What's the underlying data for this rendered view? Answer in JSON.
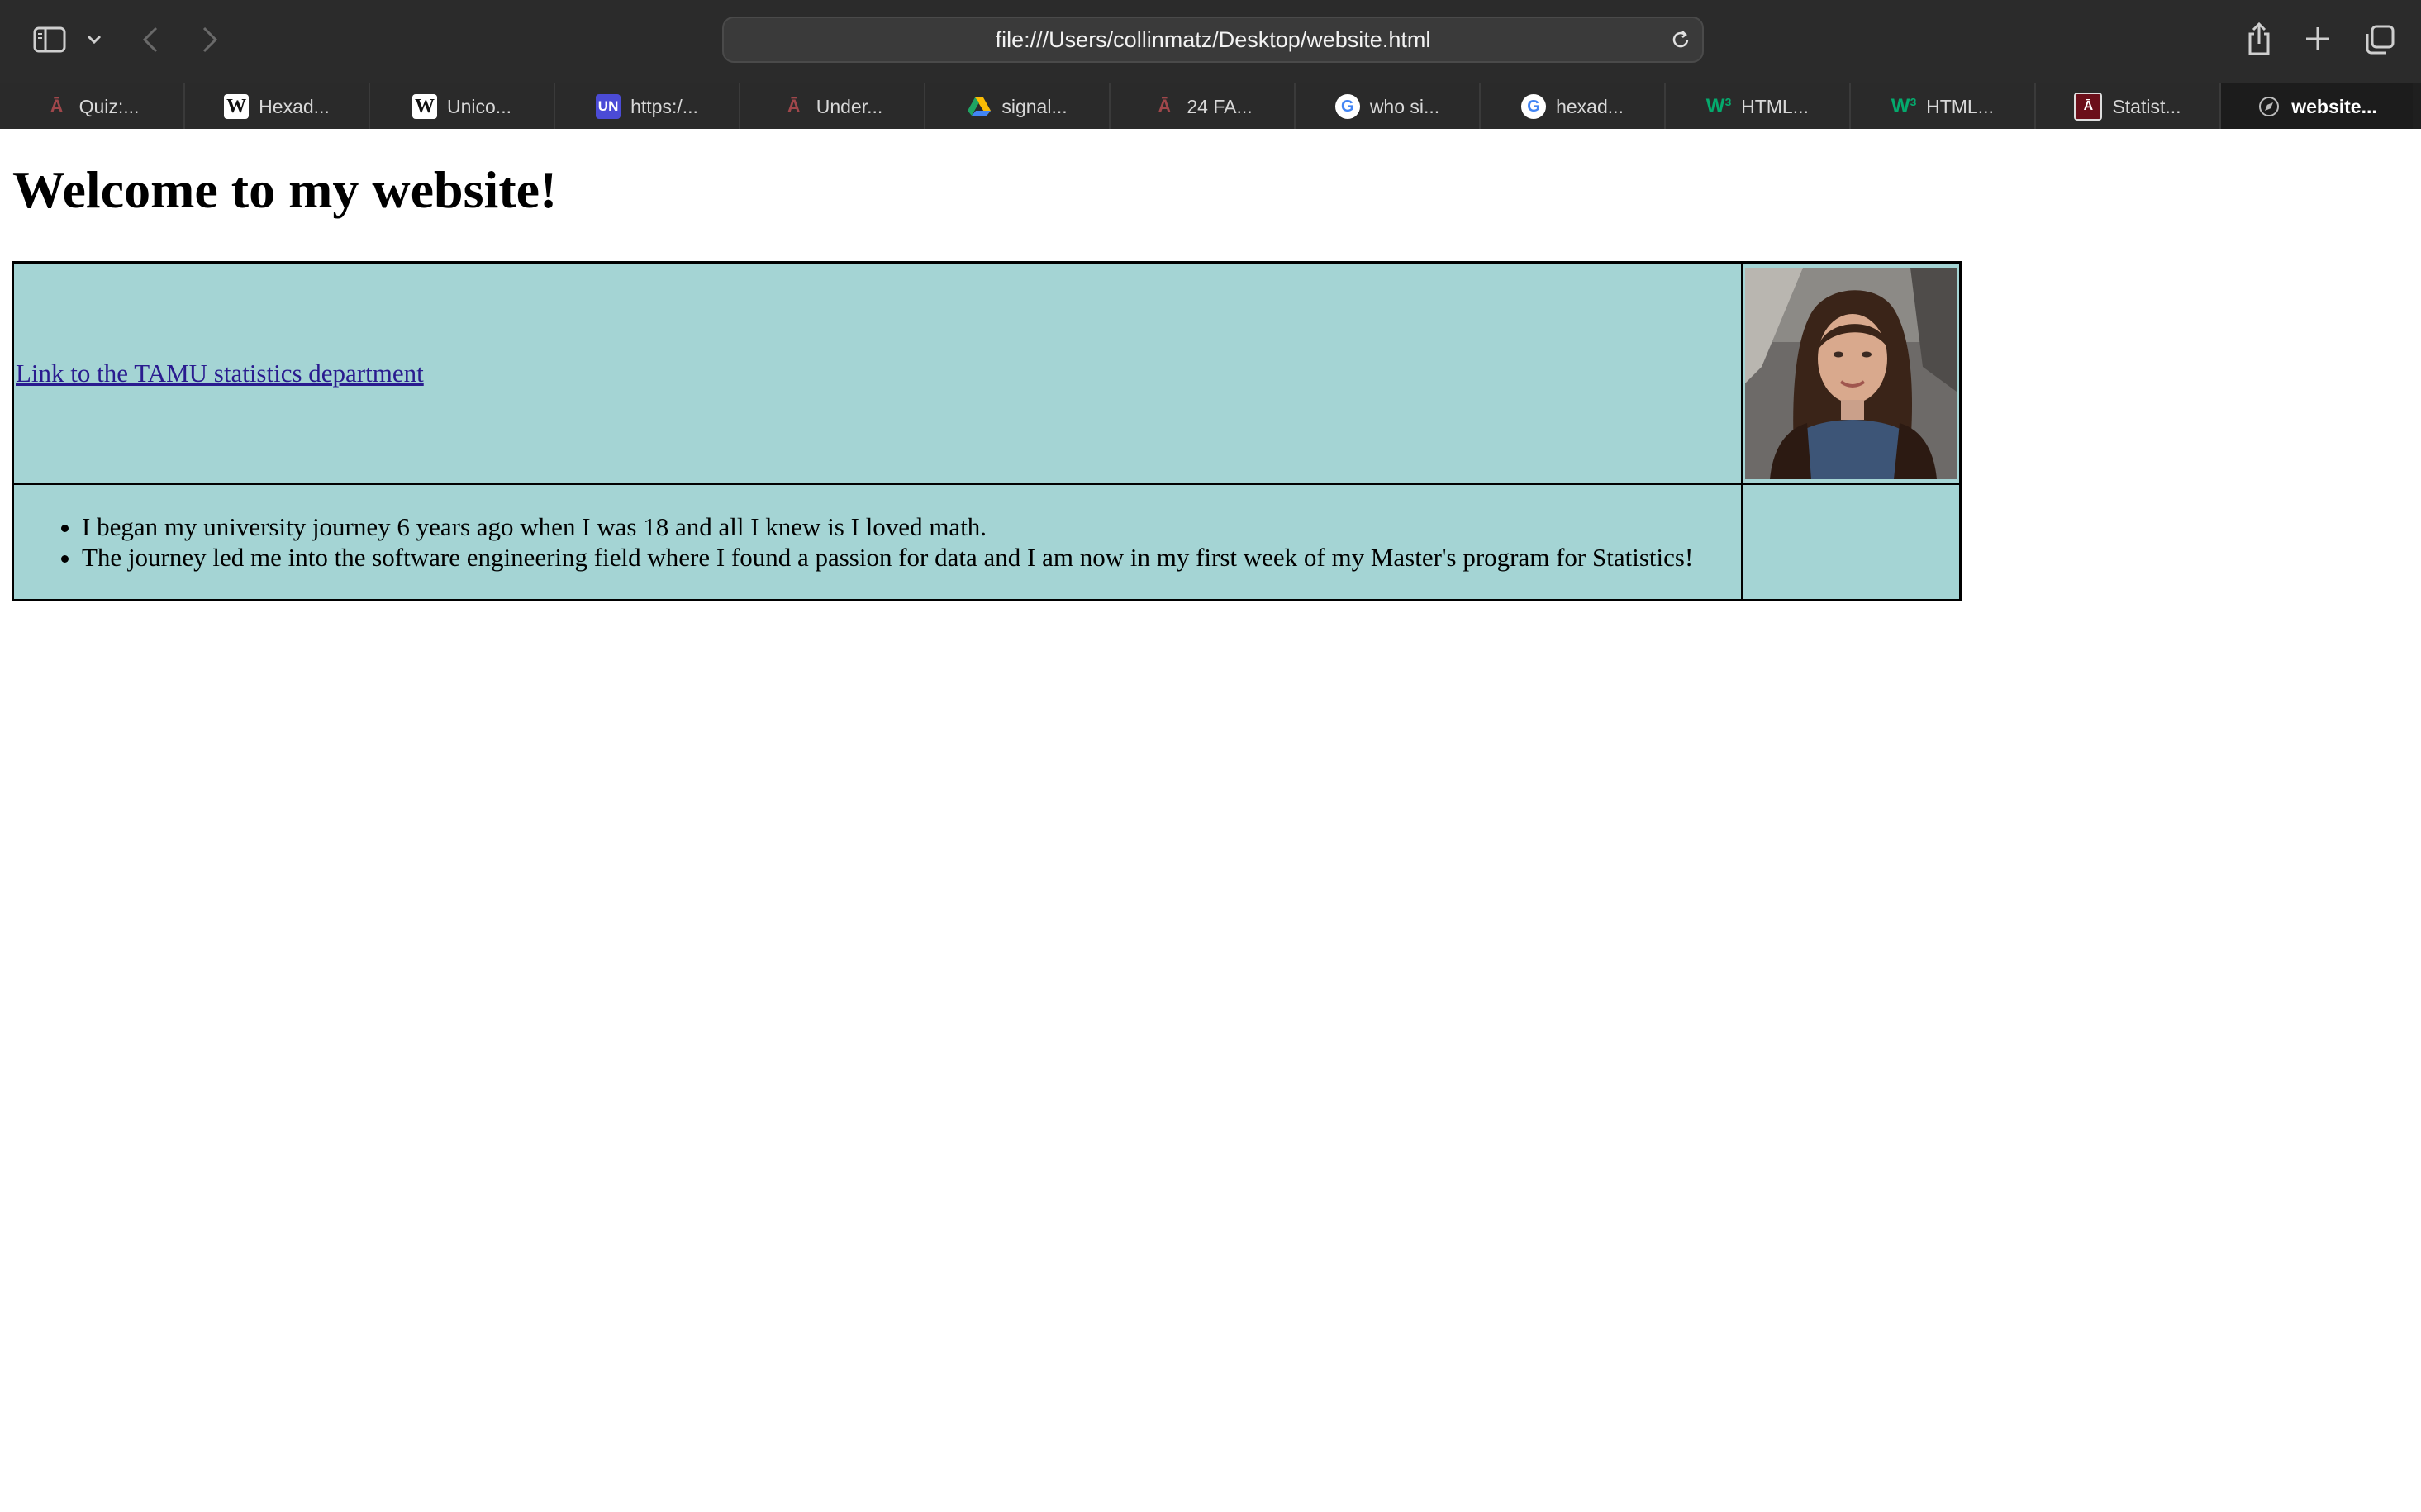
{
  "browser": {
    "address": "file:///Users/collinmatz/Desktop/website.html",
    "tabs": [
      {
        "label": "Quiz:...",
        "favicon": "tamu-atm-icon",
        "active": false
      },
      {
        "label": "Hexad...",
        "favicon": "wikipedia-w-icon",
        "active": false
      },
      {
        "label": "Unico...",
        "favicon": "wikipedia-w-icon",
        "active": false
      },
      {
        "label": "https:/...",
        "favicon": "un-icon",
        "active": false
      },
      {
        "label": "Under...",
        "favicon": "tamu-atm-icon",
        "active": false
      },
      {
        "label": "signal...",
        "favicon": "google-drive-icon",
        "active": false
      },
      {
        "label": "24 FA...",
        "favicon": "tamu-atm-icon",
        "active": false
      },
      {
        "label": "who si...",
        "favicon": "google-icon",
        "active": false
      },
      {
        "label": "hexad...",
        "favicon": "google-icon",
        "active": false
      },
      {
        "label": "HTML...",
        "favicon": "w3schools-icon",
        "active": false
      },
      {
        "label": "HTML...",
        "favicon": "w3schools-icon",
        "active": false
      },
      {
        "label": "Statist...",
        "favicon": "tamu-stat-icon",
        "active": false
      },
      {
        "label": "website...",
        "favicon": "compass-icon",
        "active": true
      }
    ]
  },
  "page": {
    "title": "Welcome to my website!",
    "link_text": "Link to the TAMU statistics department",
    "journey_items": [
      "I began my university journey 6 years ago when I was 18 and all I knew is I loved math.",
      "The journey led me into the software engineering field where I found a passion for data and I am now in my first week of my Master's program for Statistics!"
    ],
    "table_bg": "#a4d4d4",
    "link_color": "#2a1b8f"
  }
}
